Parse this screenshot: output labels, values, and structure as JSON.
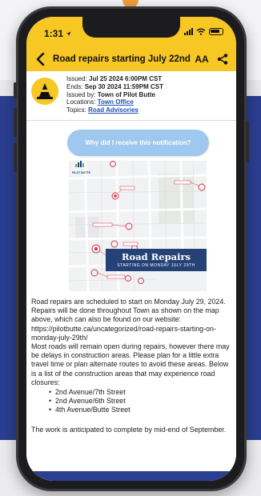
{
  "status_bar": {
    "time": "1:31"
  },
  "nav": {
    "title": "Road repairs starting July 22nd",
    "text_size_label": "AA"
  },
  "meta": {
    "issued_label": "Issued:",
    "issued_value": "Jul 25 2024 6:00PM CST",
    "ends_label": "Ends:",
    "ends_value": "Sep 30 2024 11:59PM CST",
    "issued_by_label": "Issued by:",
    "issued_by_value": "Town of Pilot Butte",
    "locations_label": "Locations:",
    "locations_value": "Town Office",
    "topics_label": "Topics:",
    "topics_value": "Road Advisories"
  },
  "why_button_label": "Why did I receive this notification?",
  "map_image": {
    "logo_text": "PILOT BUTTE",
    "banner_title": "Road Repairs",
    "banner_subtitle": "STARTING ON MONDAY JULY 29TH"
  },
  "body": {
    "paragraph_1": "Road repairs are scheduled to start on Monday July 29, 2024. Repairs will be done throughout Town as shown on the map above, which can also be found on our website: https://pilotbutte.ca/uncategorized/road-repairs-starting-on-monday-july-29th/",
    "paragraph_2": "Most roads will remain open during repairs, however there may be delays in construction areas. Please plan for a little extra travel time or plan alternate routes to avoid these areas. Below is a list of the construction areas that may experience road closures:",
    "closures": [
      "2nd Avenue/7th Street",
      "2nd Avenue/6th Street",
      "4th Avenue/Butte Street"
    ],
    "closing": "The work is anticipated to complete by mid-end of September."
  },
  "colors": {
    "accent_yellow": "#f7c823",
    "link_blue": "#1e4fb6",
    "band_blue": "#2b3f91",
    "button_blue": "#9ec8ee",
    "banner_navy": "#254276",
    "marker_red": "#d8304a"
  },
  "icons": {
    "back": "back-arrow-icon",
    "share": "share-icon",
    "advisory": "traffic-cone-icon",
    "signal": "signal-icon",
    "wifi": "wifi-icon",
    "battery": "battery-icon",
    "location": "location-arrow-icon"
  }
}
